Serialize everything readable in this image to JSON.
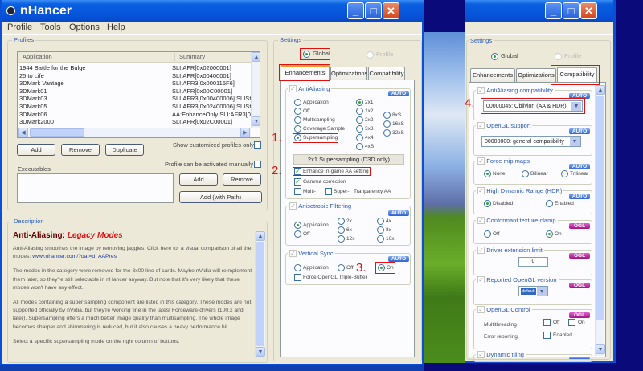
{
  "main_window": {
    "title": "nHancer",
    "menu": [
      "Profile",
      "Tools",
      "Options",
      "Help"
    ],
    "profiles": {
      "label": "Profiles",
      "columns": [
        "Application",
        "Summary"
      ],
      "rows": [
        [
          "1944 Battle for the Bulge",
          "SLI:AFR[0x02000001]"
        ],
        [
          "25 to Life",
          "SLI:AFR[0x00400001]"
        ],
        [
          "3DMark Vantage",
          "SLI:AFR3[0x000115F6]"
        ],
        [
          "3DMark01",
          "SLI:AFR[0x00C00001]"
        ],
        [
          "3DMark03",
          "SLI:AFR3[0x00400006] SLISt"
        ],
        [
          "3DMark05",
          "SLI:AFR3[0x02400006] SLISt"
        ],
        [
          "3DMark06",
          "AA:EnhanceOnly SLI:AFR3[0"
        ],
        [
          "3DMark2000",
          "SLI:AFR[0x02C00001]"
        ]
      ],
      "add": "Add",
      "remove": "Remove",
      "duplicate": "Duplicate",
      "show_customized": "Show customized profiles only",
      "activated_manually": "Profile can be activated manually",
      "executables": "Executables",
      "exe_add": "Add",
      "exe_remove": "Remove",
      "exe_add_path": "Add (with Path)"
    },
    "description": {
      "label": "Description",
      "heading": "Anti-Aliasing:",
      "heading_accent": "Legacy Modes",
      "p1": "Anti-Aliasing smoothes the image by removing jaggies. Click here for a visual comparison of all the modes: ",
      "link": "www.nhancer.com/?dat=d_AAPres",
      "p2": "The modes in the category were removed for the 8x00 line of cards. Maybe nVidia will reimplement them later, so they're still selectable in nHancer anyway. But note that it's very likely that these modes won't have any effect.",
      "p3": "All modes containing a super sampling component are listed in this category. These modes are not supported officially by nVidia, but they're working fine in the latest Forceware-drivers (100.x and later). Supersampling offers a much better image quality than multisampling. The whole image becomes sharper and shimmering is reduced, but it also causes a heavy performance hit.",
      "p4": "Select a specific supersampling mode on the right column of buttons."
    },
    "settings": {
      "label": "Settings",
      "global": "Global",
      "profile": "Profile",
      "tabs": [
        "Enhancements",
        "Optimizations",
        "Compatibility"
      ],
      "aa": {
        "label": "AntiAliasing",
        "badge": "AUTO",
        "modes": [
          "Application",
          "Off",
          "Multisampling",
          "Coverage Sample",
          "Supersampling"
        ],
        "levels": [
          "2x1",
          "1x2",
          "2x2",
          "3x3",
          "4x4",
          "4xS"
        ],
        "levels2": [
          "8xS",
          "16xS",
          "32xS"
        ],
        "selected_text": "2x1 Supersampling (D3D only)",
        "enhance": "Enhance in-game AA setting",
        "gamma": "Gamma correction",
        "multi": "Multi-",
        "super": "Super-",
        "transparency": "Tranparency AA"
      },
      "af": {
        "label": "Anisotropic Filtering",
        "badge": "AUTO",
        "modes": [
          "Application",
          "Off"
        ],
        "levels": [
          "2x",
          "6x",
          "12x",
          "4x",
          "8x",
          "16x"
        ]
      },
      "vsync": {
        "label": "Vertical Sync",
        "badge": "AUTO",
        "application": "Application",
        "off": "Off",
        "on": "On",
        "triple": "Force OpenGL Triple-Buffer"
      }
    },
    "annotations": [
      "1.",
      "2.",
      "3."
    ]
  },
  "second_window": {
    "settings_label": "Settings",
    "global": "Global",
    "profile": "Profile",
    "tabs": [
      "Enhancements",
      "Optimizations",
      "Compatibility"
    ],
    "annotation": "4.",
    "aa_compat": {
      "label": "AntiAliasing compatibility",
      "badge": "AUTO",
      "value": "00000045: Oblivion (AA & HDR)"
    },
    "ogl_support": {
      "label": "OpenGL support",
      "badge": "AUTO",
      "value": "00000000: general compatibility"
    },
    "mip": {
      "label": "Force mip maps",
      "badge": "AUTO",
      "none": "None",
      "bilinear": "Bilinear",
      "trilinear": "Trilinear"
    },
    "hdr": {
      "label": "High Dynamic Range (HDR)",
      "badge": "AUTO",
      "disabled": "Disabled",
      "enabled": "Enabled"
    },
    "clamp": {
      "label": "Conformant texture clamp",
      "badge": "OGL",
      "off": "Off",
      "on": "On"
    },
    "ext": {
      "label": "Driver extension limit",
      "badge": "OGL",
      "value": "0"
    },
    "version": {
      "label": "Reported OpenGL version",
      "badge": "OGL",
      "value": "default"
    },
    "control": {
      "label": "OpenGL Control",
      "badge": "OGL",
      "multithreading": "Multithreading",
      "off": "Off",
      "on": "On",
      "error": "Error reporting",
      "enabled": "Enabled"
    },
    "tiling": {
      "label": "Dynamic tiling"
    }
  }
}
